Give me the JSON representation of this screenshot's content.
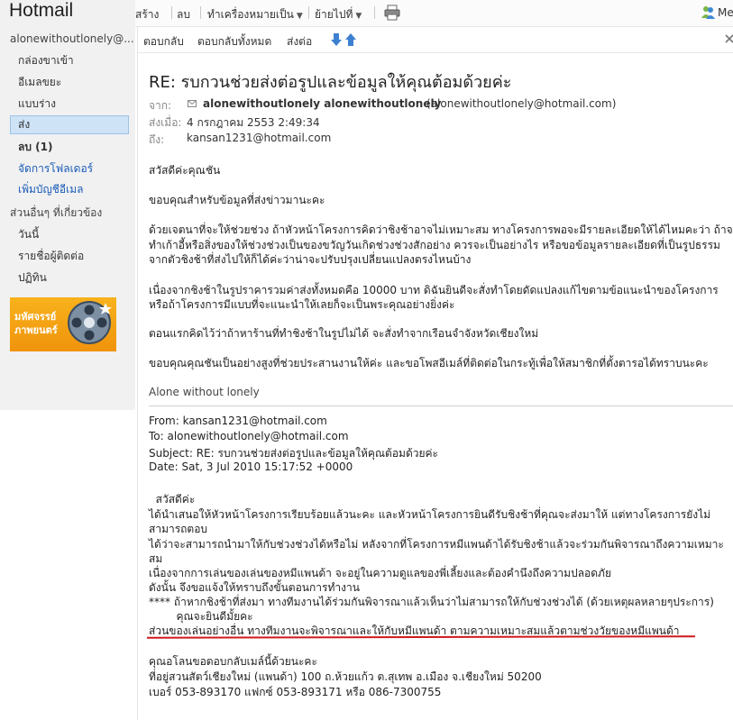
{
  "app": {
    "brand": "Hotmail"
  },
  "account": {
    "email": "alonewithoutlonely@..."
  },
  "folders": [
    {
      "label": "กล่องขาเข้า"
    },
    {
      "label": "อีเมลขยะ"
    },
    {
      "label": "แบบร่าง"
    },
    {
      "label": "ส่ง"
    },
    {
      "label": "ลบ (1)"
    }
  ],
  "folder_links": [
    {
      "label": "จัดการโฟลเดอร์"
    },
    {
      "label": "เพิ่มบัญชีอีเมล"
    }
  ],
  "related": {
    "heading": "ส่วนอื่นๆ ที่เกี่ยวข้อง",
    "items": [
      {
        "label": "วันนี้"
      },
      {
        "label": "รายชื่อผู้ติดต่อ"
      },
      {
        "label": "ปฏิทิน"
      }
    ]
  },
  "promo": {
    "text": "มหัศจรรย์ ภาพยนตร์"
  },
  "toolbar": {
    "create": "สร้าง",
    "delete": "ลบ",
    "mark_as": "ทำเครื่องหมายเป็น",
    "move_to": "ย้ายไปที่",
    "messenger": "Me"
  },
  "actions": {
    "reply": "ตอบกลับ",
    "reply_all": "ตอบกลับทั้งหมด",
    "forward": "ส่งต่อ"
  },
  "message": {
    "subject": "RE: รบกวนช่วยส่งต่อรูปและข้อมูลให้คุณต้อมด้วยค่ะ",
    "from_label": "จาก:",
    "from_name": "alonewithoutlonely alonewithoutlonely",
    "from_email": "(alonewithoutlonely@hotmail.com)",
    "sent_label": "ส่งเมื่อ:",
    "sent_value": "4 กรกฎาคม 2553 2:49:34",
    "to_label": "ถึง:",
    "to_value": "kansan1231@hotmail.com",
    "body": [
      "สวัสดีค่ะคุณชัน",
      "ขอบคุณสำหรับข้อมูลที่ส่งข่าวมานะคะ",
      "ด้วยเจตนาที่จะให้ช่วยช่วง ถ้าหัวหน้าโครงการคิดว่าชิงช้าอาจไม่เหมาะสม ทางโครงการพอจะมีรายละเอียดให้ได้ไหมคะว่า ถ้าจะ",
      "ทำเก้าอี้หรือสิ่งของให้ช่วงช่วงเป็นของขวัญวันเกิดช่วงช่วงสักอย่าง ควรจะเป็นอย่างไร หรือขอข้อมูลรายละเอียดที่เป็นรูปธรรม",
      "จากตัวชิงช้าที่ส่งไปให้ก็ได้ค่ะว่าน่าจะปรับปรุงเปลี่ยนแปลงตรงไหนบ้าง",
      "เนื่องจากชิงช้าในรูปราคารวมค่าส่งทั้งหมดคือ 10000 บาท ดิฉันยินดีจะสั่งทำโดยดัดแปลงแก้ไขตามข้อแนะนำของโครงการ",
      "หรือถ้าโครงการมีแบบที่จะแนะนำให้เลยก็จะเป็นพระคุณอย่างยิ่งค่ะ",
      "ตอนแรกคิดไว้ว่าถ้าหาร้านที่ทำชิงช้าในรูปไม่ได้ จะสั่งทำจากเรือนจำจังหวัดเชียงใหม่",
      "ขอบคุณคุณชันเป็นอย่างสูงที่ช่วยประสานงานให้ค่ะ และขอโพสอีเมล์ที่ติดต่อในกระทู้เพื่อให้สมาชิกที่ตั้งตารอได้ทราบนะคะ"
    ],
    "signature": "Alone without lonely",
    "quoted": {
      "from": "From: kansan1231@hotmail.com",
      "to": "To: alonewithoutlonely@hotmail.com",
      "subject": "Subject: RE: รบกวนช่วยส่งต่อรูปและข้อมูลให้คุณต้อมด้วยค่ะ",
      "date": "Date: Sat, 3 Jul 2010 15:17:52 +0000",
      "lines": [
        "  สวัสดีค่ะ",
        "ได้นำเสนอให้หัวหน้าโครงการเรียบร้อยแล้วนะคะ และหัวหน้าโครงการยินดีรับชิงช้าที่คุณจะส่งมาให้ แต่ทางโครงการยังไม่",
        "สามารถตอบ",
        "ได้ว่าจะสามารถนำมาให้กับช่วงช่วงได้หรือไม่ หลังจากที่โครงการหมีแพนด้าได้รับชิงช้าแล้วจะร่วมกันพิจารณาถึงความเหมาะ",
        "สม",
        "เนื่องจากการเล่นของเล่นของหมีแพนด้า จะอยู่ในความดูแลของพี่เลี้ยงและต้องคำนึงถึงความปลอดภัย",
        "ดังนั้น จึงขอแจ้งให้ทราบถึงขั้นตอนการทำงาน",
        "**** ถ้าหากชิงช้าที่ส่งมา ทางทีมงานได้ร่วมกันพิจารณาแล้วเห็นว่าไม่สามารถให้กับช่วงช่วงได้ (ด้วยเหตุผลหลายๆประการ)",
        "        คุณจะยินดีมั้ยคะ",
        "ส่วนของเล่นอย่างอื่น ทางทีมงานจะพิจารณาและให้กับหมีแพนด้า ตามความเหมาะสมแล้วตามช่วงวัยของหมีแพนด้า",
        "คุณอโลนขอตอบกลับเมล์นี้ด้วยนะคะ",
        "ที่อยู่สวนสัตว์เชียงใหม่ (แพนด้า) 100 ถ.ห้วยแก้ว ต.สุเทพ อ.เมือง จ.เชียงใหม่ 50200",
        "เบอร์ 053-893170 แฟกซ์ 053-893171 หรือ 086-7300755"
      ]
    }
  },
  "colors": {
    "link": "#1a5bb8",
    "selected_bg": "#cfe3f7",
    "underline": "#d0191c"
  },
  "icons": [
    "print-icon",
    "messenger-icon",
    "envelope-icon",
    "arrow-down-icon",
    "arrow-up-icon",
    "close-icon",
    "film-reel-icon"
  ]
}
